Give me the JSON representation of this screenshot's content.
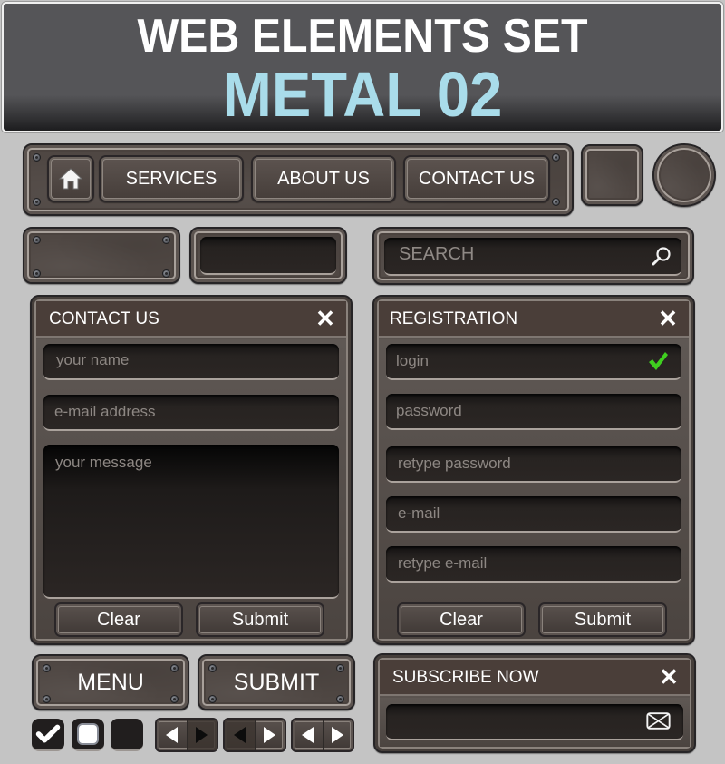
{
  "header": {
    "title_line1": "WEB ELEMENTS SET",
    "title_line2": "METAL 02",
    "accent_color": "#a9dcea"
  },
  "nav": {
    "home_icon": "home-icon",
    "items": [
      {
        "label": "SERVICES"
      },
      {
        "label": "ABOUT US"
      },
      {
        "label": "CONTACT US"
      }
    ]
  },
  "search": {
    "placeholder": "SEARCH",
    "icon": "magnifier-icon"
  },
  "contact_panel": {
    "title": "CONTACT US",
    "close_icon": "close-icon",
    "fields": [
      {
        "placeholder": "your name"
      },
      {
        "placeholder": "e-mail address"
      }
    ],
    "message_placeholder": "your message",
    "buttons": {
      "clear": "Clear",
      "submit": "Submit"
    }
  },
  "registration_panel": {
    "title": "REGISTRATION",
    "close_icon": "close-icon",
    "fields": [
      {
        "placeholder": "login",
        "valid": true
      },
      {
        "placeholder": "password"
      },
      {
        "placeholder": "retype password"
      },
      {
        "placeholder": "e-mail"
      },
      {
        "placeholder": "retype e-mail"
      }
    ],
    "valid_color": "#3fcf1f",
    "buttons": {
      "clear": "Clear",
      "submit": "Submit"
    }
  },
  "big_buttons": {
    "menu": "MENU",
    "submit": "SUBMIT"
  },
  "subscribe_panel": {
    "title": "SUBSCRIBE NOW",
    "close_icon": "close-icon",
    "input_icon": "envelope-icon"
  },
  "checkboxes": [
    {
      "state": "checked"
    },
    {
      "state": "indeterminate"
    },
    {
      "state": "unchecked"
    }
  ],
  "arrow_pairs": [
    {
      "active": "right"
    },
    {
      "active": "left"
    },
    {
      "active": "none"
    }
  ]
}
